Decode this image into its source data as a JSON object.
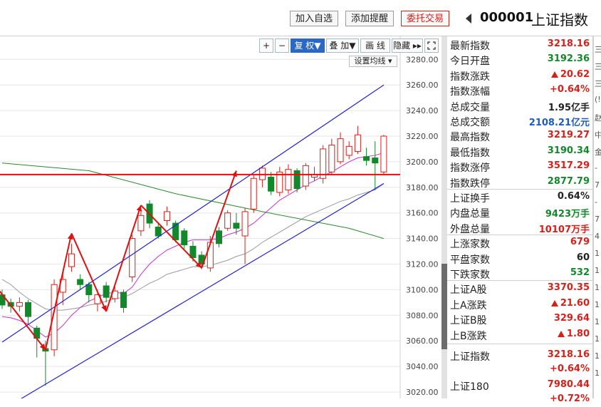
{
  "header": {
    "buttons": [
      {
        "label": "加入自选",
        "color": "#222222"
      },
      {
        "label": "添加提醒",
        "color": "#222222"
      },
      {
        "label": "委托交易",
        "color": "#d8201a"
      }
    ],
    "stock_code": "000001",
    "stock_name": "上证指数"
  },
  "chart_toolbar": {
    "plus": "+",
    "minus": "−",
    "fuquan": "复 权▼",
    "diejia": "叠 加▼",
    "huaxian": "画 线",
    "yincang": "隐藏 ▸▸",
    "fullscreen_icon": "expand-icon",
    "ma_settings": "设置均线 ▾"
  },
  "colors": {
    "up": "#d8201a",
    "down": "#13882a",
    "volume": "#1e5bbd",
    "channel": "#2424d8",
    "resistance": "#e01010",
    "ma_short": "#cc2fd0",
    "ma_mid": "#999999",
    "ma_long": "#2d8a2d",
    "active_button": "#2b68c6"
  },
  "chart_data": {
    "type": "candlestick",
    "ylim": [
      3015,
      3298
    ],
    "yticks": [
      3020,
      3040,
      3060,
      3080,
      3100,
      3120,
      3140,
      3160,
      3180,
      3200,
      3220,
      3240,
      3260,
      3280
    ],
    "ytick_labels": [
      "3020.00",
      "3040.00",
      "3060.00",
      "3080.00",
      "3100.00",
      "3120.00",
      "3140.00",
      "3160.00",
      "3180.00",
      "3200.00",
      "3220.00",
      "3240.00",
      "3260.00",
      "3280.00"
    ],
    "candles": [
      {
        "o": 3096,
        "c": 3088,
        "h": 3100,
        "l": 3085
      },
      {
        "o": 3090,
        "c": 3087,
        "h": 3093,
        "l": 3082
      },
      {
        "o": 3087,
        "c": 3090,
        "h": 3094,
        "l": 3083
      },
      {
        "o": 3090,
        "c": 3079,
        "h": 3092,
        "l": 3073
      },
      {
        "o": 3070,
        "c": 3062,
        "h": 3072,
        "l": 3047
      },
      {
        "o": 3054,
        "c": 3052,
        "h": 3060,
        "l": 3025
      },
      {
        "o": 3053,
        "c": 3104,
        "h": 3108,
        "l": 3048
      },
      {
        "o": 3098,
        "c": 3108,
        "h": 3115,
        "l": 3088
      },
      {
        "o": 3118,
        "c": 3128,
        "h": 3136,
        "l": 3114
      },
      {
        "o": 3108,
        "c": 3104,
        "h": 3112,
        "l": 3100
      },
      {
        "o": 3104,
        "c": 3096,
        "h": 3106,
        "l": 3090
      },
      {
        "o": 3089,
        "c": 3096,
        "h": 3100,
        "l": 3083
      },
      {
        "o": 3103,
        "c": 3094,
        "h": 3106,
        "l": 3090
      },
      {
        "o": 3093,
        "c": 3099,
        "h": 3103,
        "l": 3090
      },
      {
        "o": 3098,
        "c": 3086,
        "h": 3100,
        "l": 3082
      },
      {
        "o": 3110,
        "c": 3140,
        "h": 3143,
        "l": 3106
      },
      {
        "o": 3146,
        "c": 3158,
        "h": 3164,
        "l": 3142
      },
      {
        "o": 3167,
        "c": 3152,
        "h": 3170,
        "l": 3148
      },
      {
        "o": 3149,
        "c": 3142,
        "h": 3152,
        "l": 3140
      },
      {
        "o": 3154,
        "c": 3161,
        "h": 3165,
        "l": 3150
      },
      {
        "o": 3152,
        "c": 3139,
        "h": 3154,
        "l": 3137
      },
      {
        "o": 3146,
        "c": 3135,
        "h": 3148,
        "l": 3132
      },
      {
        "o": 3134,
        "c": 3125,
        "h": 3138,
        "l": 3122
      },
      {
        "o": 3127,
        "c": 3120,
        "h": 3130,
        "l": 3116
      },
      {
        "o": 3117,
        "c": 3137,
        "h": 3142,
        "l": 3114
      },
      {
        "o": 3146,
        "c": 3136,
        "h": 3149,
        "l": 3133
      },
      {
        "o": 3148,
        "c": 3160,
        "h": 3162,
        "l": 3146
      },
      {
        "o": 3152,
        "c": 3148,
        "h": 3160,
        "l": 3143
      },
      {
        "o": 3142,
        "c": 3161,
        "h": 3164,
        "l": 3120
      },
      {
        "o": 3163,
        "c": 3187,
        "h": 3190,
        "l": 3160
      },
      {
        "o": 3186,
        "c": 3195,
        "h": 3197,
        "l": 3180
      },
      {
        "o": 3188,
        "c": 3177,
        "h": 3192,
        "l": 3174
      },
      {
        "o": 3176,
        "c": 3192,
        "h": 3196,
        "l": 3173
      },
      {
        "o": 3178,
        "c": 3194,
        "h": 3198,
        "l": 3175
      },
      {
        "o": 3193,
        "c": 3179,
        "h": 3195,
        "l": 3176
      },
      {
        "o": 3181,
        "c": 3197,
        "h": 3199,
        "l": 3178
      },
      {
        "o": 3188,
        "c": 3190,
        "h": 3196,
        "l": 3185
      },
      {
        "o": 3187,
        "c": 3210,
        "h": 3213,
        "l": 3183
      },
      {
        "o": 3192,
        "c": 3213,
        "h": 3218,
        "l": 3190
      },
      {
        "o": 3200,
        "c": 3218,
        "h": 3223,
        "l": 3198
      },
      {
        "o": 3205,
        "c": 3212,
        "h": 3216,
        "l": 3202
      },
      {
        "o": 3208,
        "c": 3221,
        "h": 3228,
        "l": 3206
      },
      {
        "o": 3204,
        "c": 3201,
        "h": 3211,
        "l": 3197
      },
      {
        "o": 3203,
        "c": 3199,
        "h": 3216,
        "l": 3178
      },
      {
        "o": 3192,
        "c": 3220,
        "h": 3221,
        "l": 3190
      }
    ],
    "ma_short": [
      3079,
      3078,
      3076,
      3073,
      3068,
      3063,
      3066,
      3072,
      3080,
      3086,
      3091,
      3094,
      3097,
      3098,
      3097,
      3102,
      3112,
      3120,
      3126,
      3131,
      3134,
      3137,
      3139,
      3139,
      3139,
      3140,
      3143,
      3145,
      3148,
      3152,
      3158,
      3164,
      3170,
      3174,
      3178,
      3182,
      3185,
      3189,
      3192,
      3196,
      3200,
      3203,
      3204,
      3205,
      3207
    ],
    "ma_mid": [
      3108,
      3104,
      3098,
      3093,
      3089,
      3085,
      3084,
      3084,
      3085,
      3086,
      3088,
      3089,
      3091,
      3093,
      3094,
      3097,
      3101,
      3105,
      3108,
      3112,
      3114,
      3116,
      3118,
      3118,
      3119,
      3121,
      3123,
      3126,
      3128,
      3132,
      3137,
      3141,
      3145,
      3149,
      3153,
      3157,
      3160,
      3163,
      3166,
      3169,
      3171,
      3174,
      3176,
      3178,
      3183
    ],
    "ma_long_points": [
      [
        0,
        3199
      ],
      [
        10,
        3193
      ],
      [
        20,
        3175
      ],
      [
        30,
        3161
      ],
      [
        40,
        3148
      ],
      [
        44,
        3140
      ]
    ],
    "resistance": 3190,
    "channel_upper": [
      [
        0,
        3059
      ],
      [
        44,
        3260
      ]
    ],
    "channel_lower": [
      [
        0,
        3006
      ],
      [
        44,
        3183
      ]
    ],
    "wave_points": [
      [
        -1,
        3105
      ],
      [
        5,
        3053
      ],
      [
        8,
        3144
      ],
      [
        12,
        3083
      ],
      [
        16,
        3166
      ],
      [
        23,
        3117
      ],
      [
        27,
        3193
      ]
    ]
  },
  "quote_rows": [
    {
      "label": "最新指数",
      "value": "3218.16",
      "cls": "up"
    },
    {
      "label": "今日开盘",
      "value": "3192.36",
      "cls": "down"
    },
    {
      "label": "指数涨跌",
      "value": "20.62",
      "cls": "up",
      "arrow": true
    },
    {
      "label": "指数涨幅",
      "value": "+0.64%",
      "cls": "up"
    },
    {
      "label": "总成交量",
      "value": "1.95亿手",
      "cls": "dark"
    },
    {
      "label": "总成交额",
      "value": "2108.21亿元",
      "cls": "blue"
    },
    {
      "label": "最高指数",
      "value": "3219.27",
      "cls": "up"
    },
    {
      "label": "最低指数",
      "value": "3190.34",
      "cls": "down"
    },
    {
      "label": "指数涨停",
      "value": "3517.29",
      "cls": "up"
    },
    {
      "label": "指数跌停",
      "value": "2877.79",
      "cls": "down"
    },
    {
      "label": "上证换手",
      "value": "0.64%",
      "cls": "dark"
    },
    {
      "label": "内盘总量",
      "value": "9423万手",
      "cls": "down"
    },
    {
      "label": "外盘总量",
      "value": "10107万手",
      "cls": "up"
    },
    {
      "label": "上涨家数",
      "value": "679",
      "cls": "up"
    },
    {
      "label": "平盘家数",
      "value": "60",
      "cls": "dark"
    },
    {
      "label": "下跌家数",
      "value": "532",
      "cls": "down"
    },
    {
      "label": "上证A股",
      "value": "3370.35",
      "cls": "up"
    },
    {
      "label": "上A涨跌",
      "value": "21.60",
      "cls": "up",
      "arrow": true
    },
    {
      "label": "上证B股",
      "value": "329.64",
      "cls": "up"
    },
    {
      "label": "上B涨跌",
      "value": "1.80",
      "cls": "up",
      "arrow": true
    }
  ],
  "index_summary": [
    {
      "label": "上证指数",
      "value": "3218.16",
      "change": "+0.64%"
    },
    {
      "label": "上证180",
      "value": "7980.44",
      "change": "+0.72%"
    }
  ],
  "edge_fragments": [
    "三",
    "三",
    "三",
    "(!",
    "赵",
    "中",
    "金",
    "-",
    "7",
    "-",
    "7",
    "4",
    "1",
    "1",
    "1",
    "1",
    "1",
    "1",
    "1",
    "1"
  ]
}
